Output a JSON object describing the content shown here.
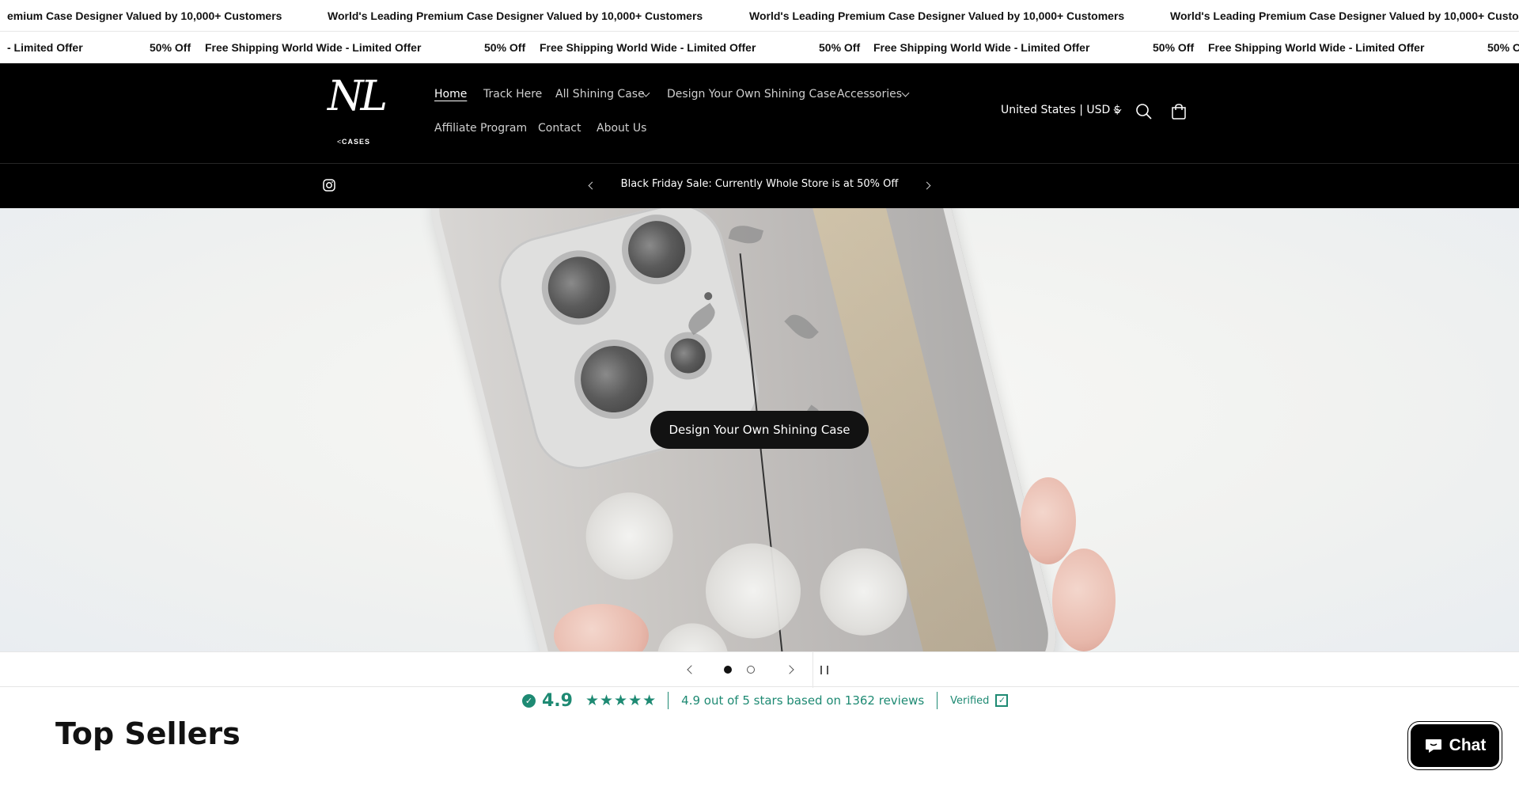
{
  "marquee_top": {
    "text": "World's Leading Premium Case Designer Valued by 10,000+ Customers",
    "partial_start": "emium Case Designer Valued by 10,000+ Customers",
    "partial_end": "World's Leading Premium Case Designer Valued by 10,000+ Custo"
  },
  "marquee_bottom": {
    "partial_start": "- Limited Offer",
    "discount": "50% Off",
    "shipping": "Free Shipping World Wide - Limited Offer"
  },
  "header": {
    "logo_mark": "NL",
    "logo_sub": "CASES",
    "nav": {
      "home": "Home",
      "track": "Track Here",
      "all_cases": "All Shining Case",
      "design": "Design Your Own Shining Case",
      "accessories": "Accessories",
      "affiliate": "Affiliate Program",
      "contact": "Contact",
      "about": "About Us"
    },
    "locale": "United States | USD $"
  },
  "announcement": {
    "text": "Black Friday Sale: Currently Whole Store is at 50% Off"
  },
  "hero": {
    "cta": "Design Your Own Shining Case",
    "active_slide": 1,
    "slide_count": 2
  },
  "rating": {
    "score": "4.9",
    "stars": "★★★★★",
    "summary": "4.9 out of 5 stars based on 1362 reviews",
    "verified": "Verified"
  },
  "section": {
    "title": "Top Sellers"
  },
  "chat": {
    "label": "Chat"
  },
  "colors": {
    "accent_green": "#1e8a73",
    "header_bg": "#000000"
  }
}
